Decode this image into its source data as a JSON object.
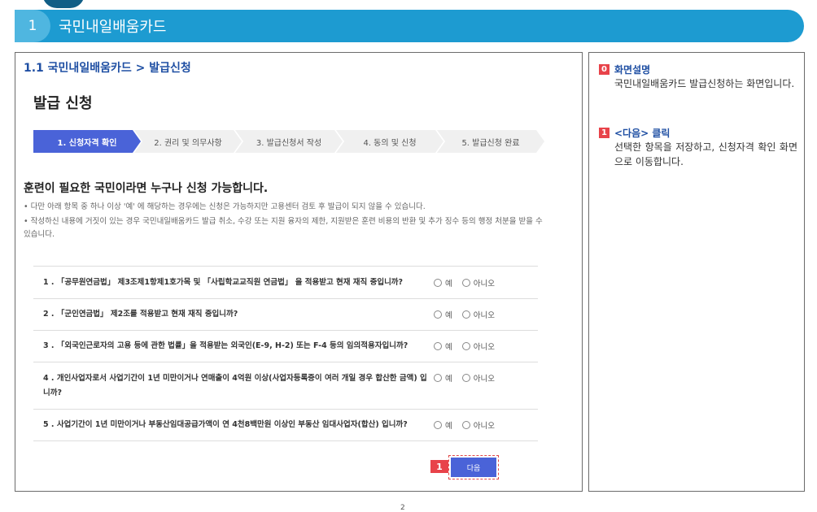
{
  "banner": {
    "number": "1",
    "title": "국민내일배움카드"
  },
  "breadcrumb": "1.1 국민내일배움카드 > 발급신청",
  "page_title": "발급 신청",
  "steps": [
    {
      "label": "1. 신청자격 확인",
      "active": true
    },
    {
      "label": "2. 권리 및 의무사항",
      "active": false
    },
    {
      "label": "3. 발급신청서 작성",
      "active": false
    },
    {
      "label": "4. 동의 및 신청",
      "active": false
    },
    {
      "label": "5. 발급신청 완료",
      "active": false
    }
  ],
  "lead": "훈련이 필요한 국민이라면 누구나 신청 가능합니다.",
  "notes": [
    "• 다만 아래 항목 중 하나 이상 '예' 에 해당하는 경우에는 신청은 가능하지만 고용센터 검토 후 발급이 되지 않을 수 있습니다.",
    "• 작성하신 내용에 거짓이 있는 경우 국민내일배움카드 발급 취소, 수강 또는 지원 융자의 제한, 지원받은 훈련 비용의 반환 및 추가 징수 등의 행정 처분을 받을 수 있습니다."
  ],
  "questions": [
    {
      "text": "1 . 「공무원연금법」 제3조제1항제1호가목 및 「사립학교교직원 연금법」 을 적용받고 현재 재직 중입니까?",
      "yes": "예",
      "no": "아니오"
    },
    {
      "text": "2 . 「군인연금법」 제2조를 적용받고 현재 재직 중입니까?",
      "yes": "예",
      "no": "아니오"
    },
    {
      "text": "3 . 「외국인근로자의 고용 등에 관한 법률」을 적용받는 외국인(E-9, H-2) 또는 F-4 등의 임의적용자입니까?",
      "yes": "예",
      "no": "아니오"
    },
    {
      "text": "4 . 개인사업자로서 사업기간이 1년 미만이거나 연매출이 4억원 이상(사업자등록증이 여러 개일 경우 합산한 금액) 입니까?",
      "yes": "예",
      "no": "아니오"
    },
    {
      "text": "5 . 사업기간이 1년 미만이거나 부동산임대공급가액이 연 4천8백만원 이상인 부동산 임대사업자(합산) 입니까?",
      "yes": "예",
      "no": "아니오"
    }
  ],
  "next_button": {
    "label": "다음",
    "badge": "1"
  },
  "side": [
    {
      "badge": "0",
      "title": "화면설명",
      "desc": "국민내일배움카드 발급신청하는 화면입니다."
    },
    {
      "badge": "1",
      "title": "<다음> 클릭",
      "desc": "선택한 항목을 저장하고, 신청자격 확인 화면으로 이동합니다."
    }
  ],
  "page_number": "2",
  "colors": {
    "banner": "#1d9bd1",
    "accent": "#4a63d8",
    "badge": "#e8434a",
    "link": "#1f4fa3"
  }
}
